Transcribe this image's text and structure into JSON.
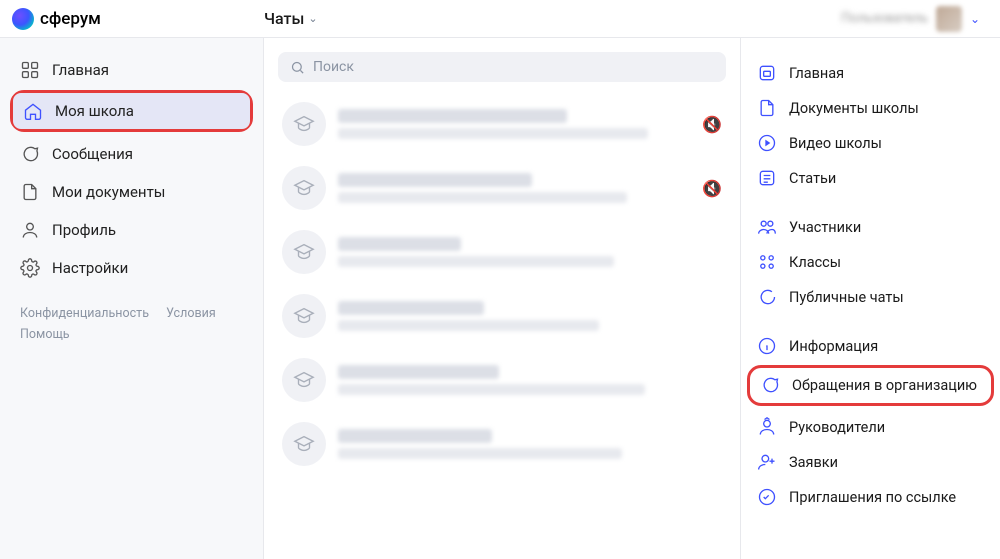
{
  "brand": {
    "name": "сферум"
  },
  "header": {
    "title": "Чаты",
    "user_name": "Пользователь"
  },
  "sidebar": {
    "items": [
      {
        "label": "Главная"
      },
      {
        "label": "Моя школа"
      },
      {
        "label": "Сообщения"
      },
      {
        "label": "Мои документы"
      },
      {
        "label": "Профиль"
      },
      {
        "label": "Настройки"
      }
    ],
    "footer": {
      "privacy": "Конфиденциальность",
      "terms": "Условия",
      "help": "Помощь"
    }
  },
  "search": {
    "placeholder": "Поиск"
  },
  "rightmenu": {
    "group1": [
      {
        "label": "Главная"
      },
      {
        "label": "Документы школы"
      },
      {
        "label": "Видео школы"
      },
      {
        "label": "Статьи"
      }
    ],
    "group2": [
      {
        "label": "Участники"
      },
      {
        "label": "Классы"
      },
      {
        "label": "Публичные чаты"
      }
    ],
    "group3": [
      {
        "label": "Информация"
      },
      {
        "label": "Обращения в организацию"
      },
      {
        "label": "Руководители"
      },
      {
        "label": "Заявки"
      },
      {
        "label": "Приглашения по ссылке"
      }
    ]
  }
}
